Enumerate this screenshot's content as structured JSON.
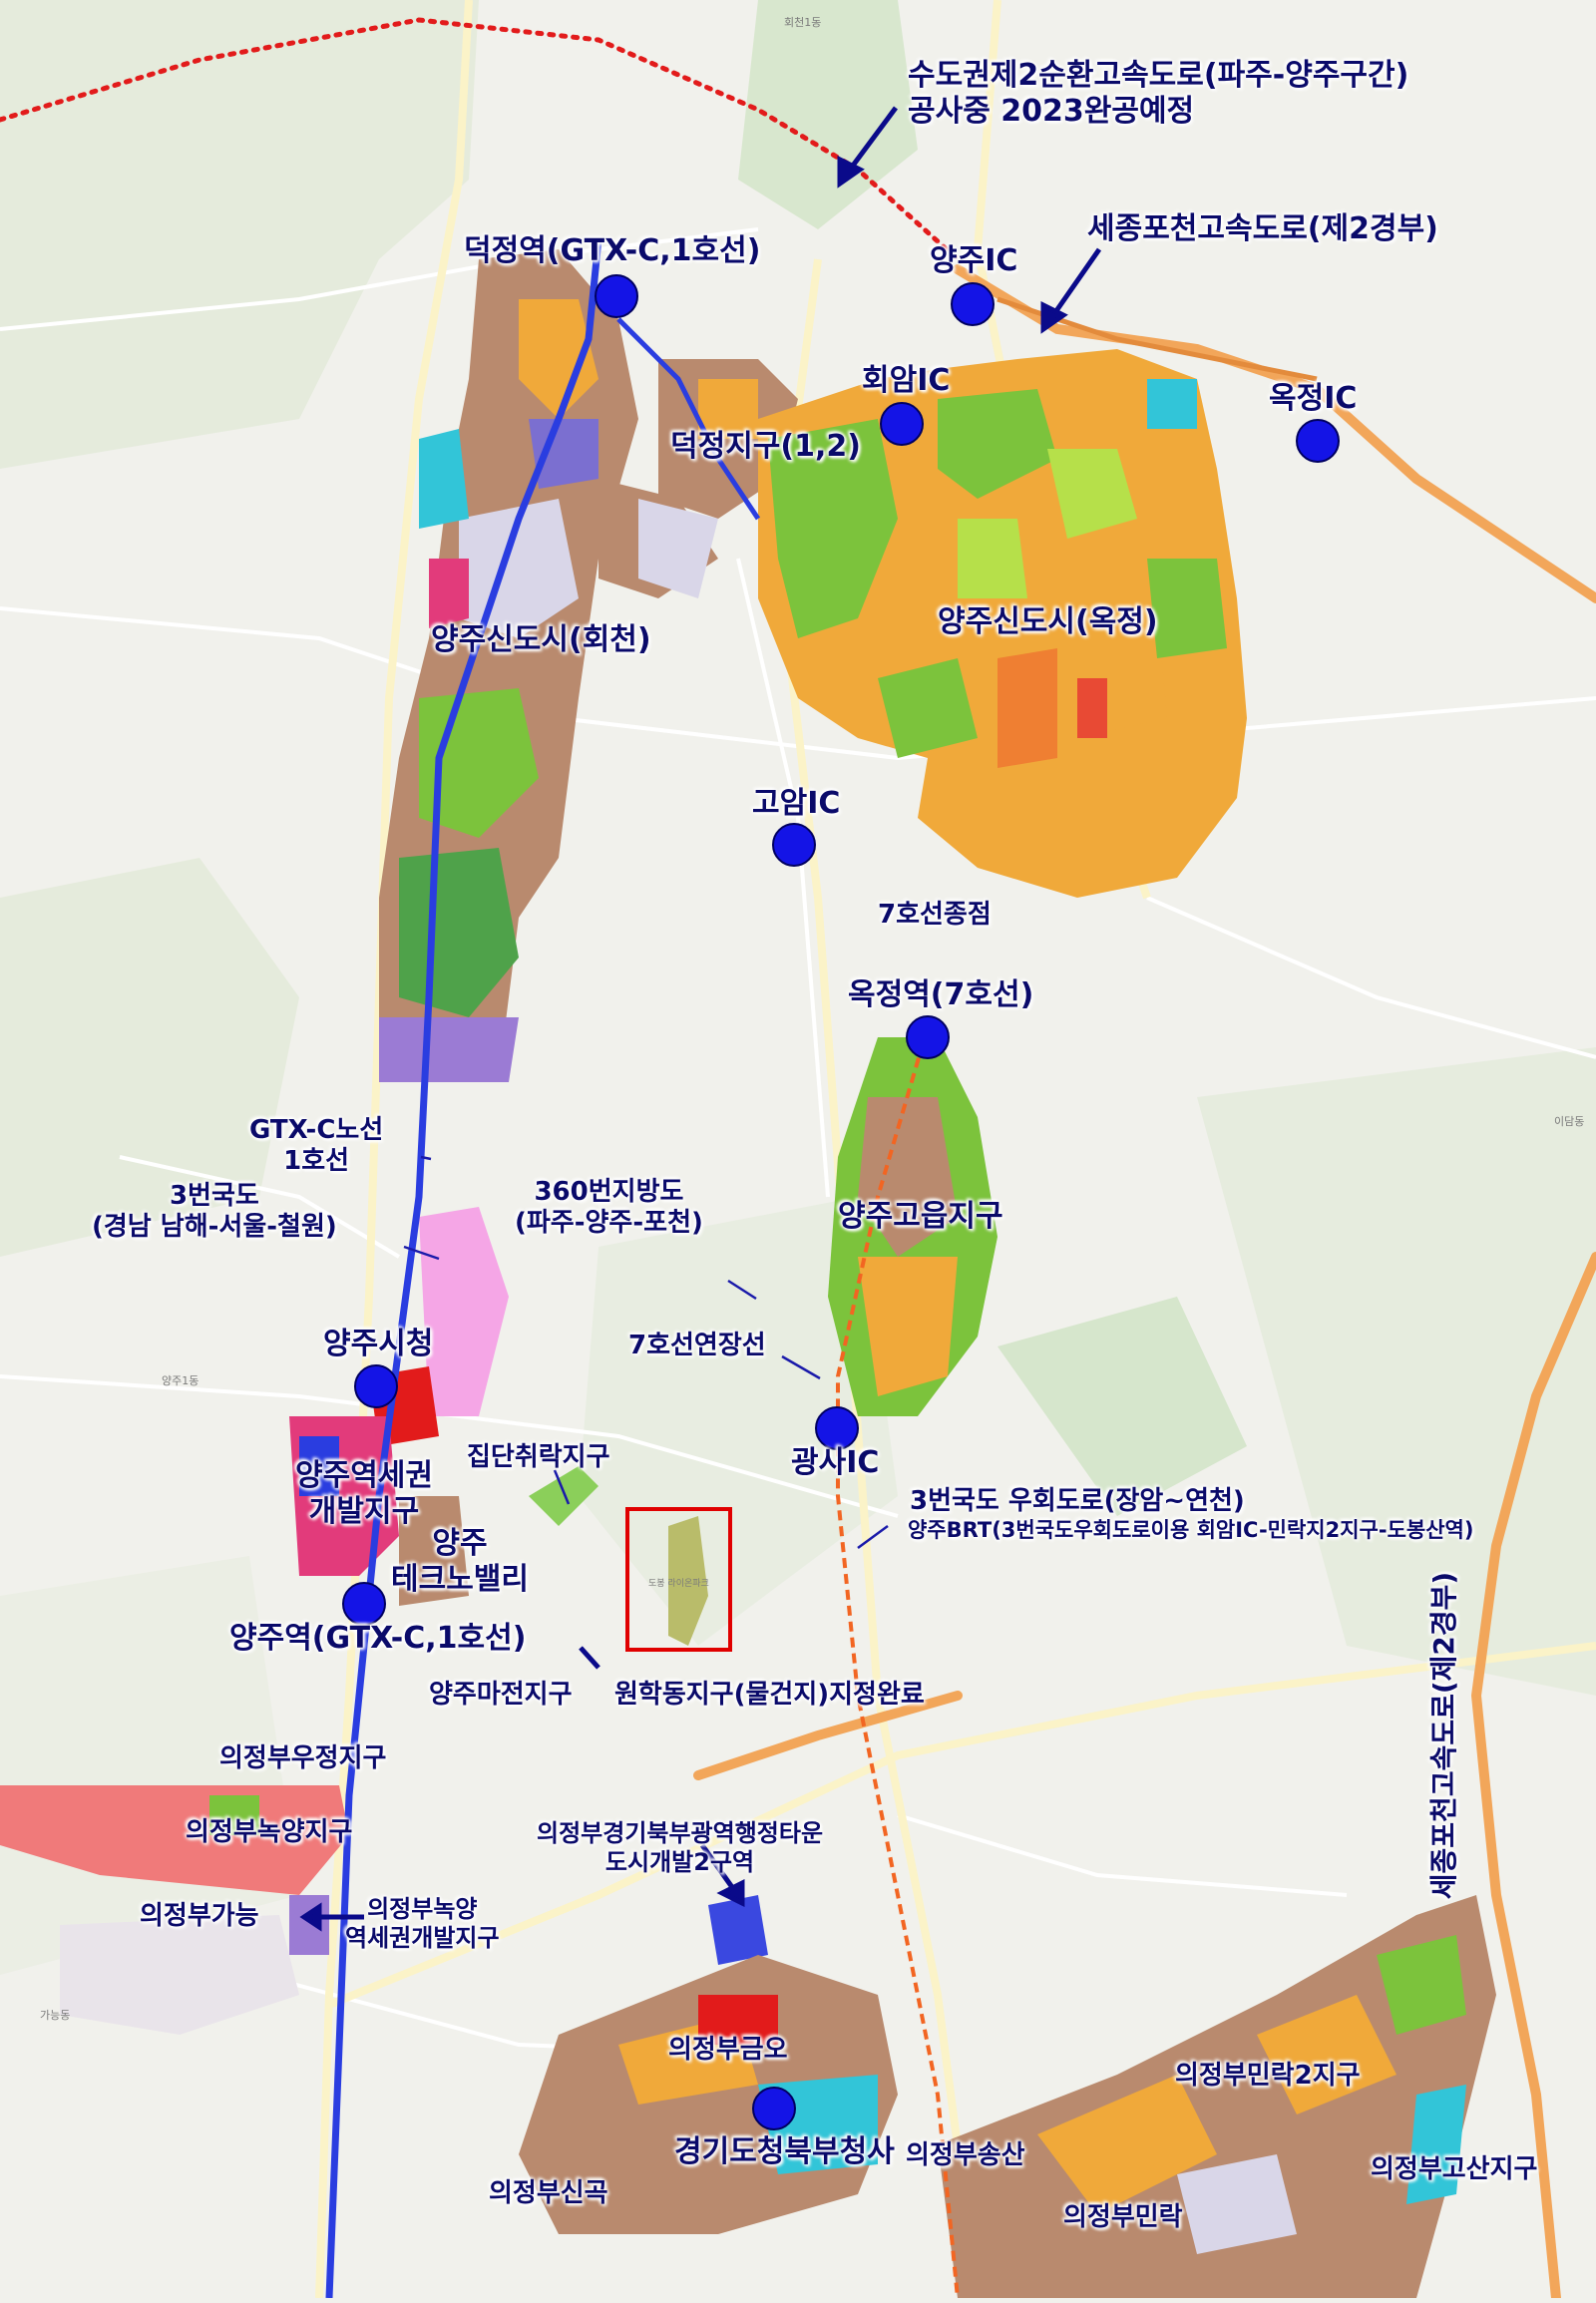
{
  "map": {
    "colors": {
      "background": "#f1f1ec",
      "forest": "#dfe8d3",
      "road_major": "#ffffff",
      "expressway": "#f2a65a",
      "residential": "#b98a6e",
      "apartment_orange": "#f0a93a",
      "park_green": "#7cc33c",
      "commercial": "#d9d6e8",
      "industrial": "#9b7bd4",
      "rail_blue": "#2a3de0",
      "marker": "#1414e6",
      "label_text": "#0a0a6a",
      "dotted_route": "#e21b1b",
      "rail_extension": "#f26522",
      "highlight_box": "#e00000"
    },
    "markers": [
      {
        "id": "deokjeong-station",
        "label": "덕정역(GTX-C,1호선)"
      },
      {
        "id": "yangju-ic",
        "label": "양주IC"
      },
      {
        "id": "hoeam-ic",
        "label": "회암IC"
      },
      {
        "id": "okjeong-ic",
        "label": "옥정IC"
      },
      {
        "id": "goam-ic",
        "label": "고암IC"
      },
      {
        "id": "okjeong-station",
        "label": "옥정역(7호선)"
      },
      {
        "id": "gwangsa-ic",
        "label": "광사IC"
      },
      {
        "id": "yangju-city-hall",
        "label": "양주시청"
      },
      {
        "id": "yangju-station",
        "label": "양주역(GTX-C,1호선)"
      },
      {
        "id": "gyeonggi-north-office",
        "label": "경기도청북부청사"
      }
    ],
    "annotations": {
      "capital_ring_1": "수도권제2순환고속도로(파주-양주구간)",
      "capital_ring_2": "공사중 2023완공예정",
      "sejong_pocheon": "세종포천고속도로(제2경부)",
      "deokjeong_district": "덕정지구(1,2)",
      "newtown_hoecheon": "양주신도시(회천)",
      "newtown_okjeong": "양주신도시(옥정)",
      "line7_terminus": "7호선종점",
      "gtx_line_1": "GTX-C노선",
      "gtx_line_2": "1호선",
      "route3_1": "3번국도",
      "route3_2": "(경남 남해-서울-철원)",
      "route360_1": "360번지방도",
      "route360_2": "(파주-양주-포천)",
      "goeup_district": "양주고읍지구",
      "line7_extension": "7호선연장선",
      "station_area_1": "양주역세권",
      "station_area_2": "개발지구",
      "cluster_village": "집단취락지구",
      "techno_1": "양주",
      "techno_2": "테크노밸리",
      "route3_bypass": "3번국도 우회도로(장암~연천)",
      "yangju_brt": "양주BRT(3번국도우회도로이용 회암IC-민락지2지구-도봉산역)",
      "majeon_district": "양주마전지구",
      "wonhak_district": "원학동지구(물건지)지정완료",
      "sejong_pocheon_vertical": "세종포천고속도로(제2경부)",
      "uijeongbu_ujeong": "의정부우정지구",
      "uijeongbu_nogyang": "의정부녹양지구",
      "gyeonggi_north_1": "의정부경기북부광역행정타운",
      "gyeonggi_north_2": "도시개발2구역",
      "uijeongbu_ganeung": "의정부가능",
      "nogyang_station_1": "의정부녹양",
      "nogyang_station_2": "역세권개발지구",
      "uijeongbu_geumo": "의정부금오",
      "uijeongbu_minrak2": "의정부민락2지구",
      "uijeongbu_singok": "의정부신곡",
      "uijeongbu_songsan": "의정부송산",
      "uijeongbu_minrak": "의정부민락",
      "uijeongbu_gosan": "의정부고산지구"
    },
    "base_labels": {
      "hoecheon1": "회천1동",
      "yangju1": "양주1동",
      "ganeung": "가능동",
      "idam": "이담동",
      "dobong_park": "도봉 라이온파크"
    }
  }
}
